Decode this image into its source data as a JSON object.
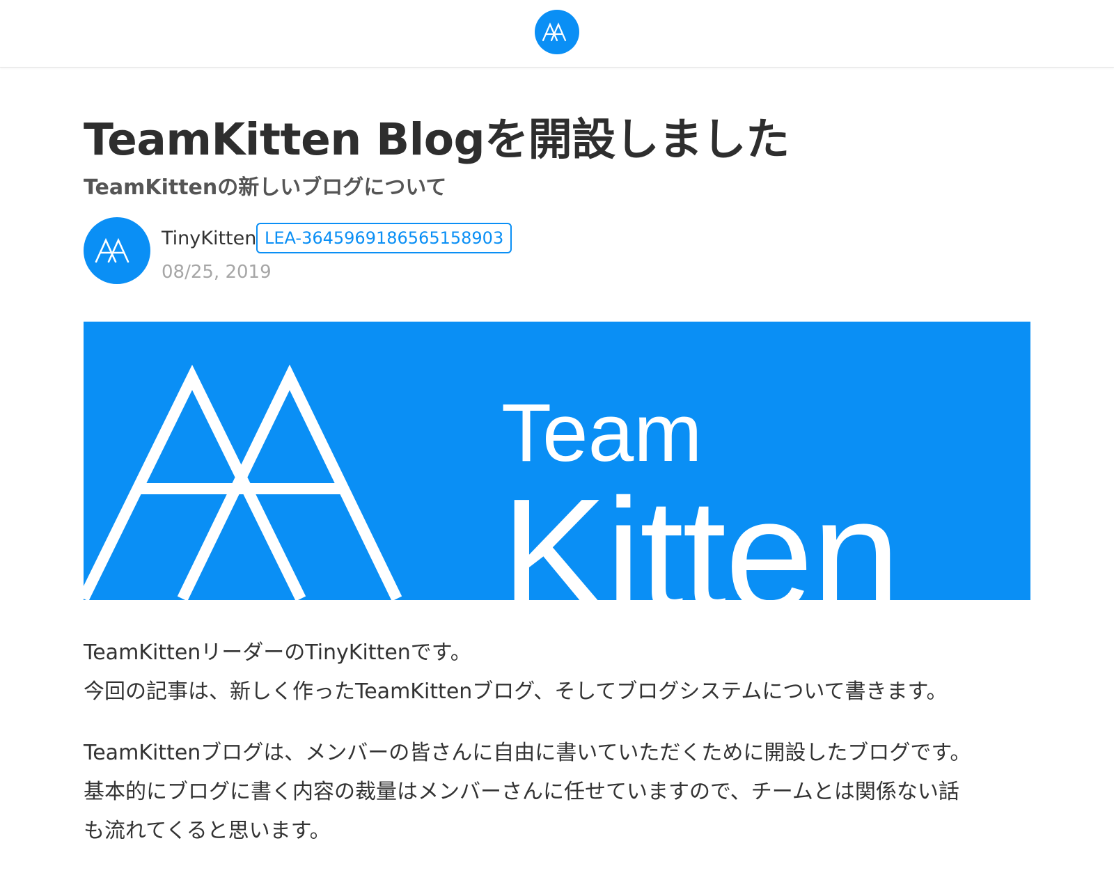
{
  "header": {
    "logo_icon": "teamkitten-logo-icon"
  },
  "article": {
    "title": "TeamKitten Blogを開設しました",
    "subtitle": "TeamKittenの新しいブログについて",
    "author": {
      "name": "TinyKitten",
      "tag": "LEA-3645969186565158903",
      "date": "08/25, 2019",
      "avatar_icon": "teamkitten-logo-icon"
    },
    "hero": {
      "logo_icon": "teamkitten-logo-icon",
      "line1": "Team",
      "line2": "Kitten"
    },
    "paragraphs": [
      {
        "lines": [
          "TeamKittenリーダーのTinyKittenです。",
          "今回の記事は、新しく作ったTeamKittenブログ、そしてブログシステムについて書きます。"
        ]
      },
      {
        "lines": [
          "TeamKittenブログは、メンバーの皆さんに自由に書いていただくために開設したブログです。",
          "基本的にブログに書く内容の裁量はメンバーさんに任せていますので、チームとは関係ない話",
          "も流れてくると思います。"
        ]
      }
    ]
  },
  "colors": {
    "brand_blue": "#0a8ff5",
    "title": "#2e2e2e",
    "muted": "#a6a6a6"
  }
}
